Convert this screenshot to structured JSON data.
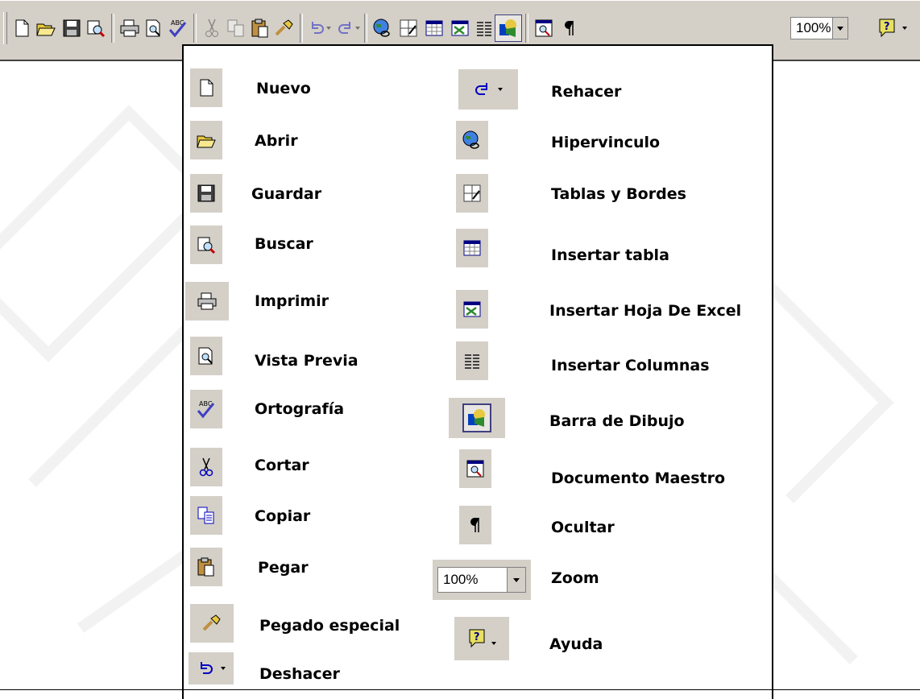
{
  "toolbar": {
    "zoom_value": "100%",
    "buttons": [
      {
        "name": "new-icon"
      },
      {
        "name": "open-icon"
      },
      {
        "name": "save-icon"
      },
      {
        "name": "search-icon"
      },
      {
        "name": "print-icon"
      },
      {
        "name": "print-preview-icon"
      },
      {
        "name": "spelling-icon"
      },
      {
        "name": "cut-icon"
      },
      {
        "name": "copy-icon"
      },
      {
        "name": "paste-icon"
      },
      {
        "name": "format-painter-icon"
      },
      {
        "name": "undo-icon"
      },
      {
        "name": "redo-icon"
      },
      {
        "name": "hyperlink-icon"
      },
      {
        "name": "tables-borders-icon"
      },
      {
        "name": "insert-table-icon"
      },
      {
        "name": "insert-excel-icon"
      },
      {
        "name": "columns-icon"
      },
      {
        "name": "drawing-icon"
      },
      {
        "name": "master-document-icon"
      },
      {
        "name": "show-hide-icon"
      },
      {
        "name": "help-icon"
      }
    ]
  },
  "legend": {
    "left": [
      {
        "label": "Nuevo",
        "icon": "new-icon"
      },
      {
        "label": "Abrir",
        "icon": "open-icon"
      },
      {
        "label": "Guardar",
        "icon": "save-icon"
      },
      {
        "label": "Buscar",
        "icon": "search-icon"
      },
      {
        "label": "Imprimir",
        "icon": "print-icon"
      },
      {
        "label": "Vista Previa",
        "icon": "print-preview-icon"
      },
      {
        "label": "Ortografía",
        "icon": "spelling-icon"
      },
      {
        "label": "Cortar",
        "icon": "cut-icon"
      },
      {
        "label": "Copiar",
        "icon": "copy-icon"
      },
      {
        "label": "Pegar",
        "icon": "paste-icon"
      },
      {
        "label": "Pegado especial",
        "icon": "format-painter-icon"
      },
      {
        "label": "Deshacer",
        "icon": "undo-icon"
      }
    ],
    "right": [
      {
        "label": "Rehacer",
        "icon": "redo-icon"
      },
      {
        "label": "Hipervinculo",
        "icon": "hyperlink-icon"
      },
      {
        "label": "Tablas y Bordes",
        "icon": "tables-borders-icon"
      },
      {
        "label": "Insertar tabla",
        "icon": "insert-table-icon"
      },
      {
        "label": "Insertar Hoja De Excel",
        "icon": "insert-excel-icon"
      },
      {
        "label": "Insertar Columnas",
        "icon": "columns-icon"
      },
      {
        "label": "Barra de Dibujo",
        "icon": "drawing-icon"
      },
      {
        "label": "Documento Maestro",
        "icon": "master-document-icon"
      },
      {
        "label": "Ocultar",
        "icon": "show-hide-icon"
      },
      {
        "label": "Zoom",
        "icon": "zoom-dropdown",
        "value": "100%"
      },
      {
        "label": "Ayuda",
        "icon": "help-icon"
      }
    ]
  },
  "colors": {
    "toolbar_bg": "#d4d0c8",
    "icon_blue": "#0000c0",
    "icon_green": "#2e8b2e",
    "icon_yellow": "#e8c840"
  }
}
